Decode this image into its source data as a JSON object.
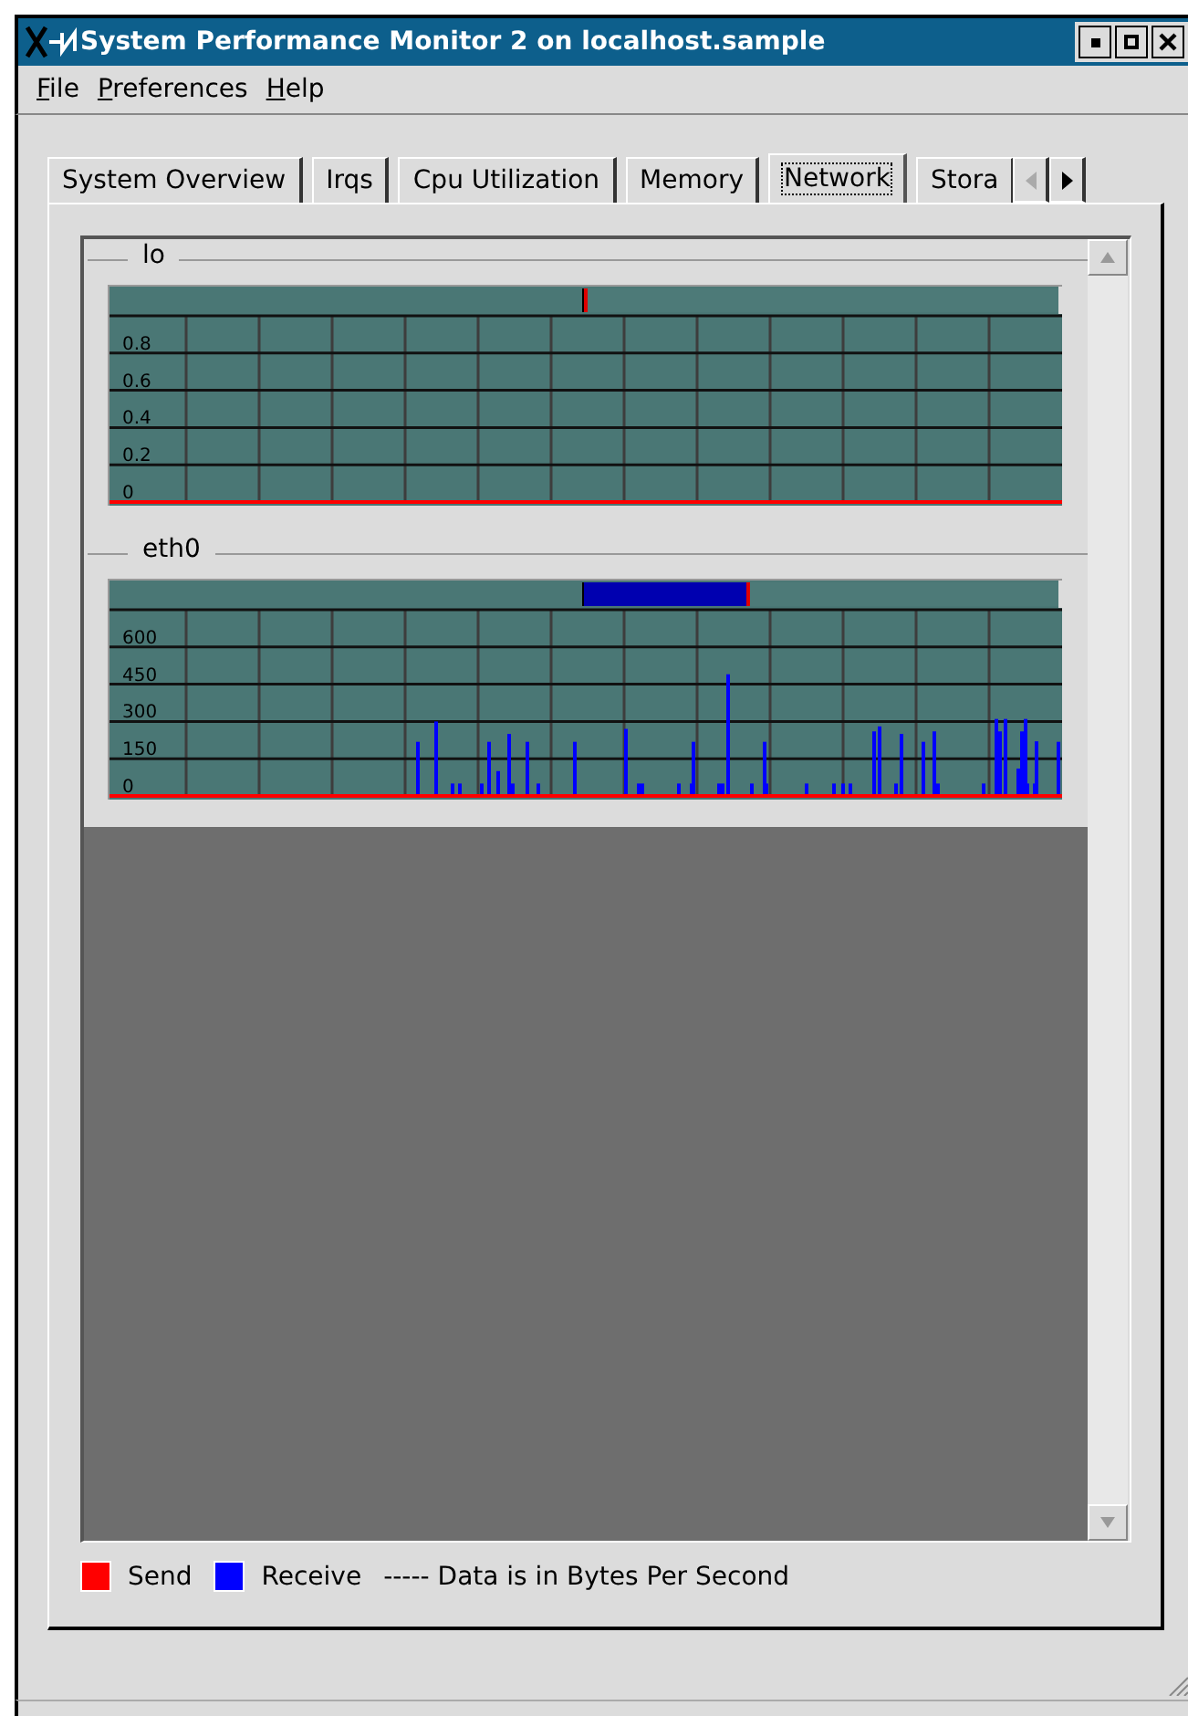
{
  "window": {
    "title": "System Performance Monitor 2  on localhost.sample"
  },
  "menu": [
    "File",
    "Preferences",
    "Help"
  ],
  "tabs": [
    {
      "label": "System Overview",
      "selected": false
    },
    {
      "label": "Irqs",
      "selected": false
    },
    {
      "label": "Cpu Utilization",
      "selected": false
    },
    {
      "label": "Memory",
      "selected": false
    },
    {
      "label": "Network",
      "selected": true
    },
    {
      "label": "Stora",
      "selected": false
    }
  ],
  "interfaces": [
    {
      "name": "lo",
      "level": 0,
      "axis_labels": [
        "0.8",
        "0.6",
        "0.4",
        "0.2",
        "0"
      ]
    },
    {
      "name": "eth0",
      "level": 0.34,
      "axis_labels": [
        "600",
        "450",
        "300",
        "150",
        "0"
      ]
    }
  ],
  "legend": [
    {
      "label": "Send",
      "color": "#ff0000"
    },
    {
      "label": "Receive",
      "color": "#0000ff"
    }
  ],
  "note": "----- Data is in Bytes Per Second"
}
